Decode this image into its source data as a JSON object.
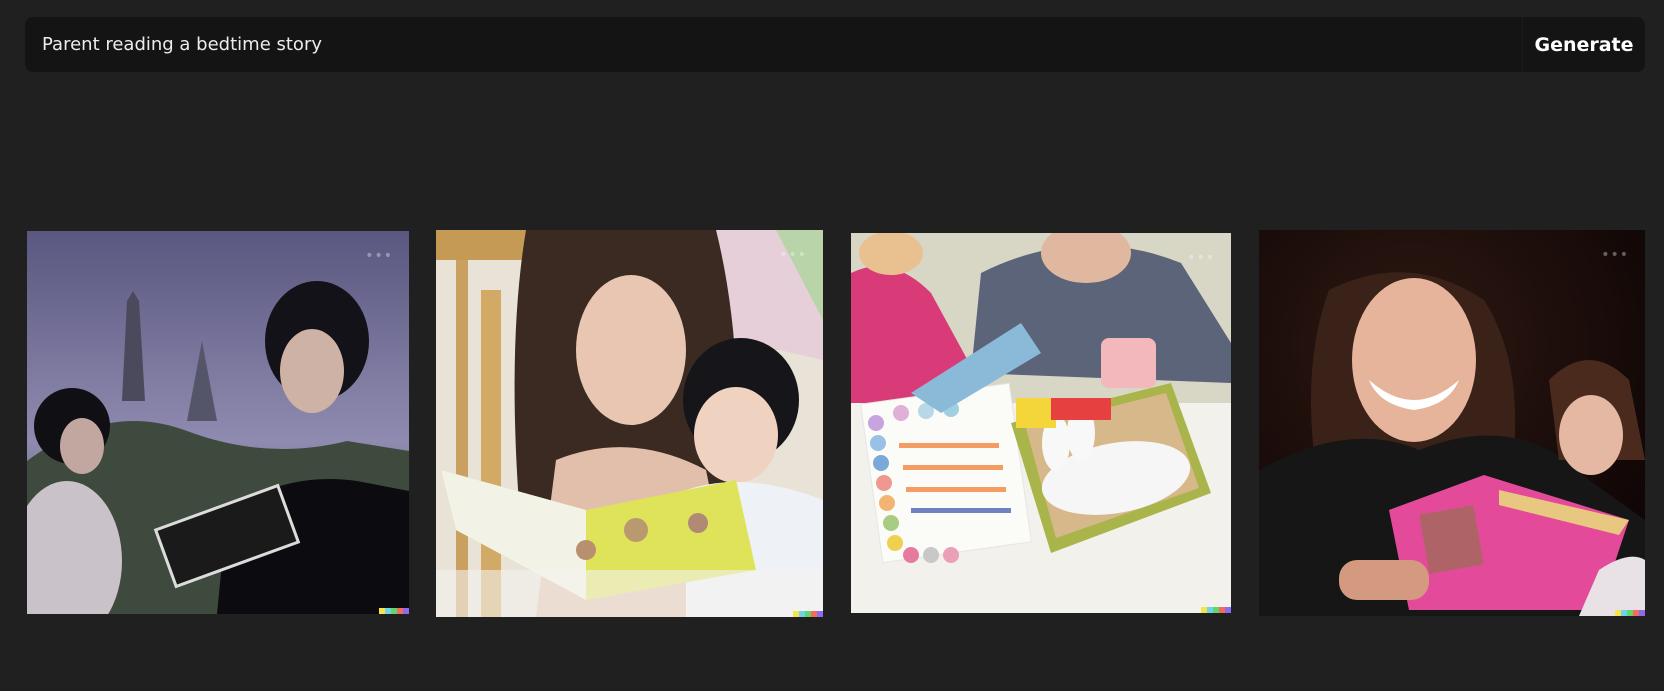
{
  "prompt": {
    "value": "Parent reading a bedtime story",
    "generate_label": "Generate"
  },
  "results": [
    {
      "icon": "generated-image-1",
      "palette": [
        "#6d6a8e",
        "#a8a4c4",
        "#0d0d12",
        "#e0c8c8"
      ]
    },
    {
      "icon": "generated-image-2",
      "palette": [
        "#c9b78f",
        "#e8dcd0",
        "#3a2a22",
        "#dce85a"
      ]
    },
    {
      "icon": "generated-image-3",
      "palette": [
        "#d9d7c0",
        "#5b6478",
        "#d93a78",
        "#a9b54a"
      ]
    },
    {
      "icon": "generated-image-4",
      "palette": [
        "#150707",
        "#2a1a16",
        "#1a1a1a",
        "#e44a9a"
      ]
    }
  ],
  "watermark_colors": [
    "#f7e34a",
    "#6fd4e8",
    "#62d66d",
    "#f56b5a",
    "#8c6bf0"
  ]
}
